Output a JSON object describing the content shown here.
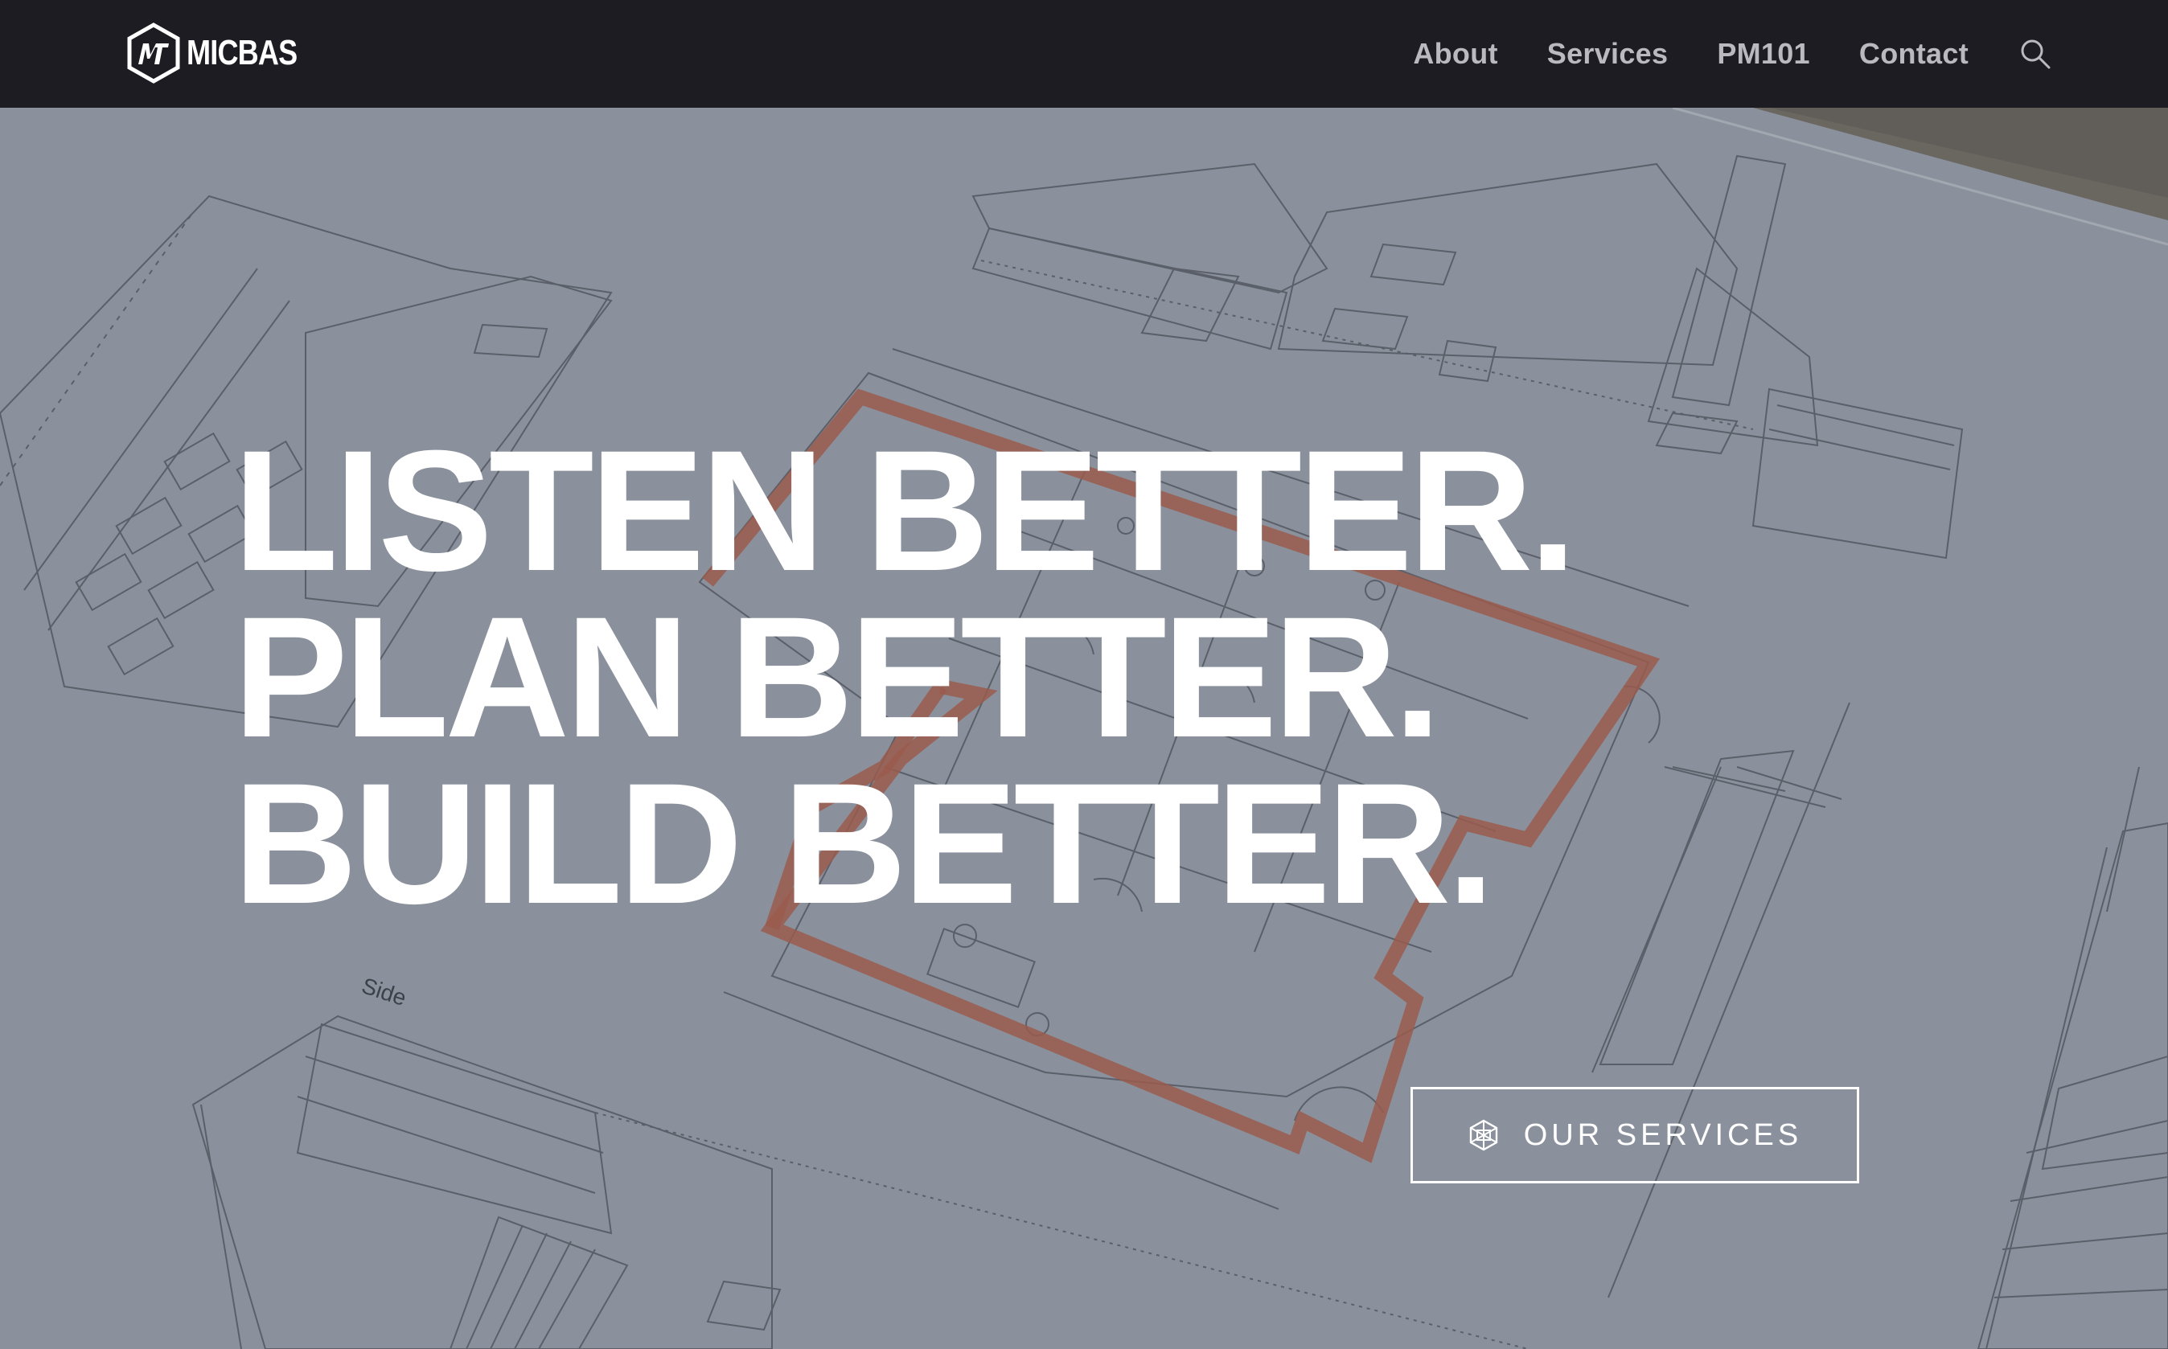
{
  "header": {
    "logo_text": "MICBAS",
    "logo_mark": "MT",
    "nav": [
      {
        "label": "About"
      },
      {
        "label": "Services"
      },
      {
        "label": "PM101"
      },
      {
        "label": "Contact"
      }
    ],
    "search_icon": "search-icon"
  },
  "hero": {
    "background": "architectural-blueprint-plans",
    "headline": [
      "LISTEN BETTER.",
      "PLAN BETTER.",
      "BUILD BETTER."
    ],
    "blueprint_label": "Side",
    "cta": {
      "label": "OUR SERVICES",
      "icon": "geodesic-cube-icon"
    }
  },
  "colors": {
    "header_bg": "#1d1c22",
    "nav_text": "#b9b9be",
    "hero_overlay": "#8a909b",
    "brick_wall": "#9a5a4c",
    "text_white": "#ffffff"
  }
}
